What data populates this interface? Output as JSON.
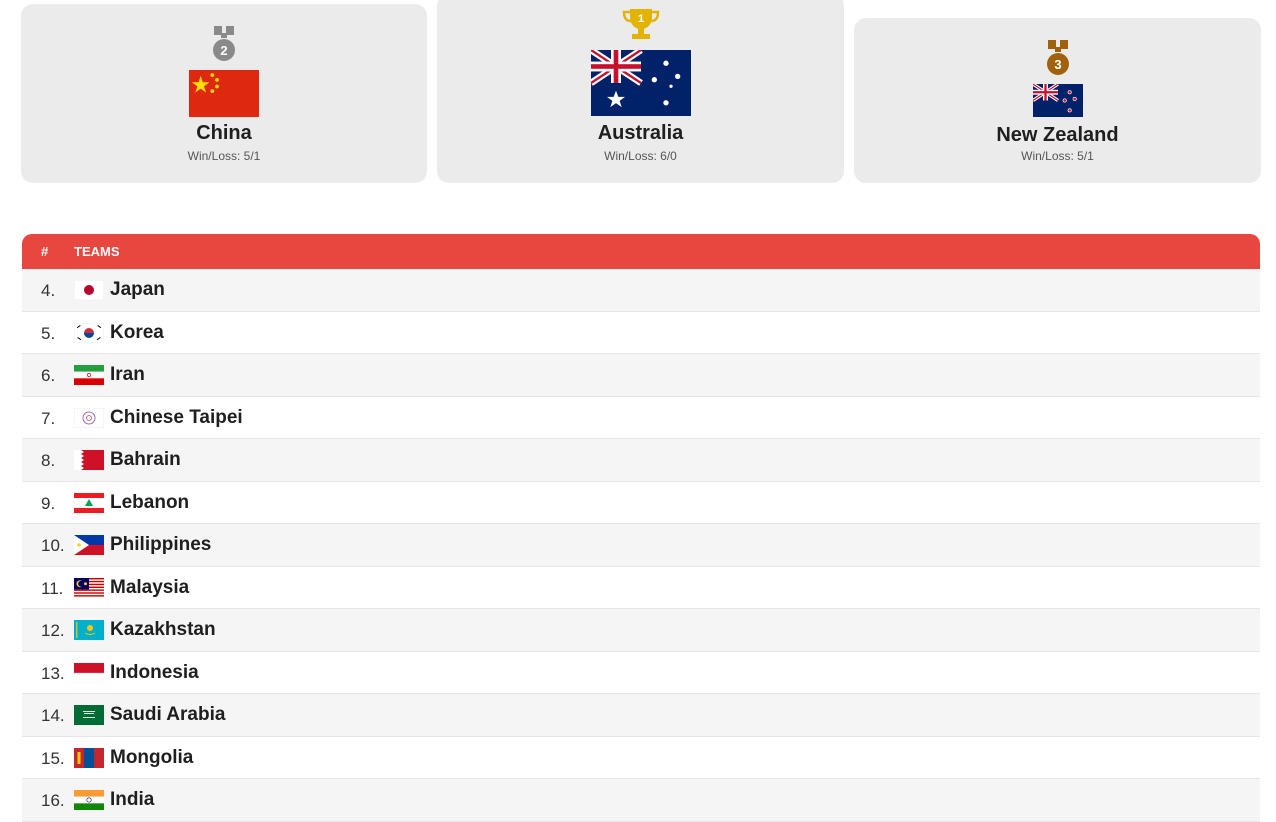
{
  "podium": [
    {
      "place": "2",
      "country": "China",
      "record_label": "Win/Loss:",
      "record": "5/1",
      "medal_color": "#8a8a8a",
      "flag_icon": "china-flag-icon"
    },
    {
      "place": "1",
      "country": "Australia",
      "record_label": "Win/Loss:",
      "record": "6/0",
      "medal_color": "#e2b400",
      "flag_icon": "australia-flag-icon"
    },
    {
      "place": "3",
      "country": "New Zealand",
      "record_label": "Win/Loss:",
      "record": "5/1",
      "medal_color": "#a0620c",
      "flag_icon": "new-zealand-flag-icon"
    }
  ],
  "table": {
    "header": {
      "num": "#",
      "teams": "TEAMS"
    },
    "header_color": "#e8473f",
    "rows": [
      {
        "rank": "4.",
        "team": "Japan",
        "flag_icon": "japan-flag-icon"
      },
      {
        "rank": "5.",
        "team": "Korea",
        "flag_icon": "korea-flag-icon"
      },
      {
        "rank": "6.",
        "team": "Iran",
        "flag_icon": "iran-flag-icon"
      },
      {
        "rank": "7.",
        "team": "Chinese Taipei",
        "flag_icon": "chinese-taipei-flag-icon"
      },
      {
        "rank": "8.",
        "team": "Bahrain",
        "flag_icon": "bahrain-flag-icon"
      },
      {
        "rank": "9.",
        "team": "Lebanon",
        "flag_icon": "lebanon-flag-icon"
      },
      {
        "rank": "10.",
        "team": "Philippines",
        "flag_icon": "philippines-flag-icon"
      },
      {
        "rank": "11.",
        "team": "Malaysia",
        "flag_icon": "malaysia-flag-icon"
      },
      {
        "rank": "12.",
        "team": "Kazakhstan",
        "flag_icon": "kazakhstan-flag-icon"
      },
      {
        "rank": "13.",
        "team": "Indonesia",
        "flag_icon": "indonesia-flag-icon"
      },
      {
        "rank": "14.",
        "team": "Saudi Arabia",
        "flag_icon": "saudi-arabia-flag-icon"
      },
      {
        "rank": "15.",
        "team": "Mongolia",
        "flag_icon": "mongolia-flag-icon"
      },
      {
        "rank": "16.",
        "team": "India",
        "flag_icon": "india-flag-icon"
      }
    ]
  }
}
